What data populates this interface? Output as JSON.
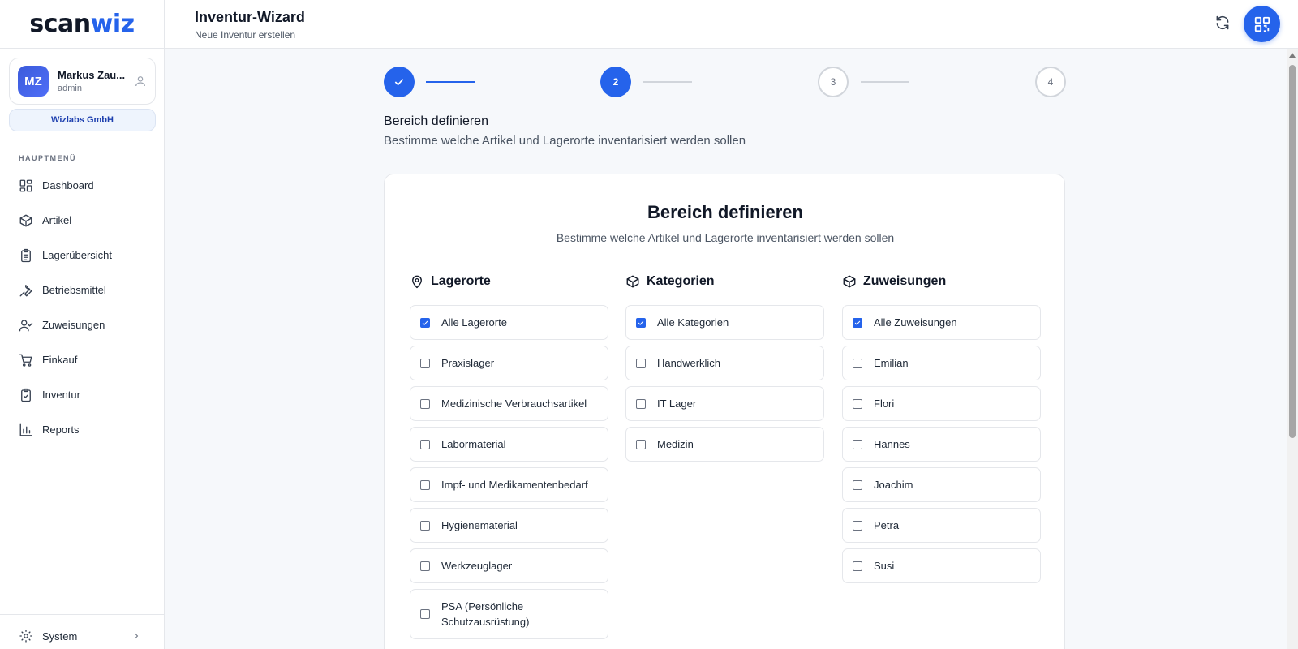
{
  "brand": {
    "part1": "scan",
    "part2": "wiz"
  },
  "user": {
    "initials": "MZ",
    "name": "Markus Zau...",
    "role": "admin"
  },
  "company": "Wizlabs GmbH",
  "menu_heading": "HAUPTMENÜ",
  "menu": [
    {
      "label": "Dashboard",
      "icon": "dashboard-icon"
    },
    {
      "label": "Artikel",
      "icon": "box-icon"
    },
    {
      "label": "Lagerübersicht",
      "icon": "clipboard-list-icon"
    },
    {
      "label": "Betriebsmittel",
      "icon": "wrench-icon"
    },
    {
      "label": "Zuweisungen",
      "icon": "user-check-icon"
    },
    {
      "label": "Einkauf",
      "icon": "cart-icon"
    },
    {
      "label": "Inventur",
      "icon": "clipboard-check-icon"
    },
    {
      "label": "Reports",
      "icon": "bar-chart-icon"
    }
  ],
  "system_label": "System",
  "header": {
    "title": "Inventur-Wizard",
    "subtitle": "Neue Inventur erstellen"
  },
  "stepper": {
    "steps": [
      {
        "label": "1",
        "state": "done"
      },
      {
        "label": "2",
        "state": "active"
      },
      {
        "label": "3",
        "state": "pending"
      },
      {
        "label": "4",
        "state": "pending"
      }
    ]
  },
  "section": {
    "title": "Bereich definieren",
    "description": "Bestimme welche Artikel und Lagerorte inventarisiert werden sollen"
  },
  "card": {
    "title": "Bereich definieren",
    "description": "Bestimme welche Artikel und Lagerorte inventarisiert werden sollen"
  },
  "columns": {
    "lagerorte": {
      "title": "Lagerorte",
      "options": [
        {
          "label": "Alle Lagerorte",
          "checked": true
        },
        {
          "label": "Praxislager",
          "checked": false
        },
        {
          "label": "Medizinische Verbrauchsartikel",
          "checked": false
        },
        {
          "label": "Labormaterial",
          "checked": false
        },
        {
          "label": "Impf- und Medikamentenbedarf",
          "checked": false
        },
        {
          "label": "Hygienematerial",
          "checked": false
        },
        {
          "label": "Werkzeuglager",
          "checked": false
        },
        {
          "label": "PSA (Persönliche Schutzausrüstung)",
          "checked": false
        }
      ]
    },
    "kategorien": {
      "title": "Kategorien",
      "options": [
        {
          "label": "Alle Kategorien",
          "checked": true
        },
        {
          "label": "Handwerklich",
          "checked": false
        },
        {
          "label": "IT Lager",
          "checked": false
        },
        {
          "label": "Medizin",
          "checked": false
        }
      ]
    },
    "zuweisungen": {
      "title": "Zuweisungen",
      "options": [
        {
          "label": "Alle Zuweisungen",
          "checked": true
        },
        {
          "label": "Emilian",
          "checked": false
        },
        {
          "label": "Flori",
          "checked": false
        },
        {
          "label": "Hannes",
          "checked": false
        },
        {
          "label": "Joachim",
          "checked": false
        },
        {
          "label": "Petra",
          "checked": false
        },
        {
          "label": "Susi",
          "checked": false
        }
      ]
    }
  },
  "colors": {
    "accent": "#2563eb",
    "border": "#e5e7eb",
    "text": "#111827"
  }
}
